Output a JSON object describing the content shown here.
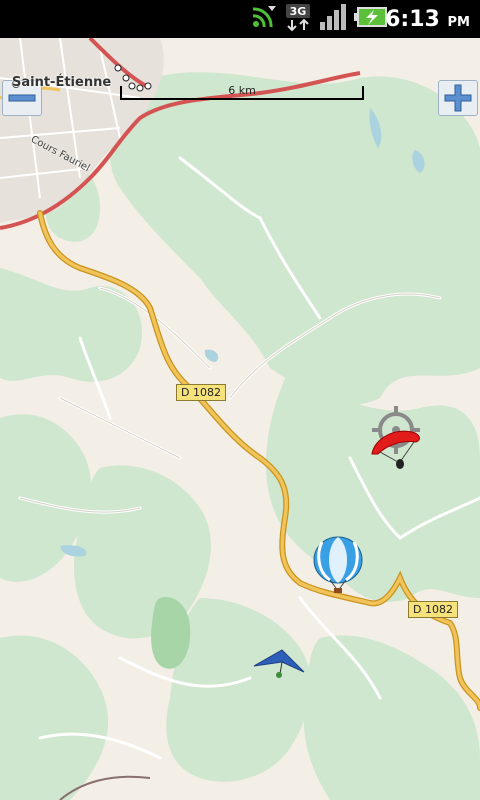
{
  "status_bar": {
    "time": "6:13",
    "ampm": "PM",
    "icons": [
      "sync-icon",
      "3g-data-icon",
      "signal-icon",
      "battery-charging-icon"
    ],
    "network_label": "3G"
  },
  "map": {
    "scale_label": "6 km",
    "place_label": "Saint-Étienne",
    "street_label": "Cours Fauriel",
    "road_label_1": "D 1082",
    "road_label_2": "D 1082",
    "colors": {
      "land": "#f3efe6",
      "forest": "#cfe6cf",
      "road_main": "#f0c45a",
      "road_main_border": "#c9941d",
      "highway": "#d45454",
      "water": "#aad3df"
    }
  },
  "markers": [
    {
      "name": "paraglider-marker",
      "icon": "paraglider-icon"
    },
    {
      "name": "balloon-marker",
      "icon": "hot-air-balloon-icon"
    },
    {
      "name": "hangglider-marker",
      "icon": "hang-glider-icon"
    },
    {
      "name": "location-target",
      "icon": "crosshair-icon"
    }
  ],
  "controls": {
    "zoom_in_icon": "plus-icon",
    "zoom_out_icon": "minus-icon"
  }
}
